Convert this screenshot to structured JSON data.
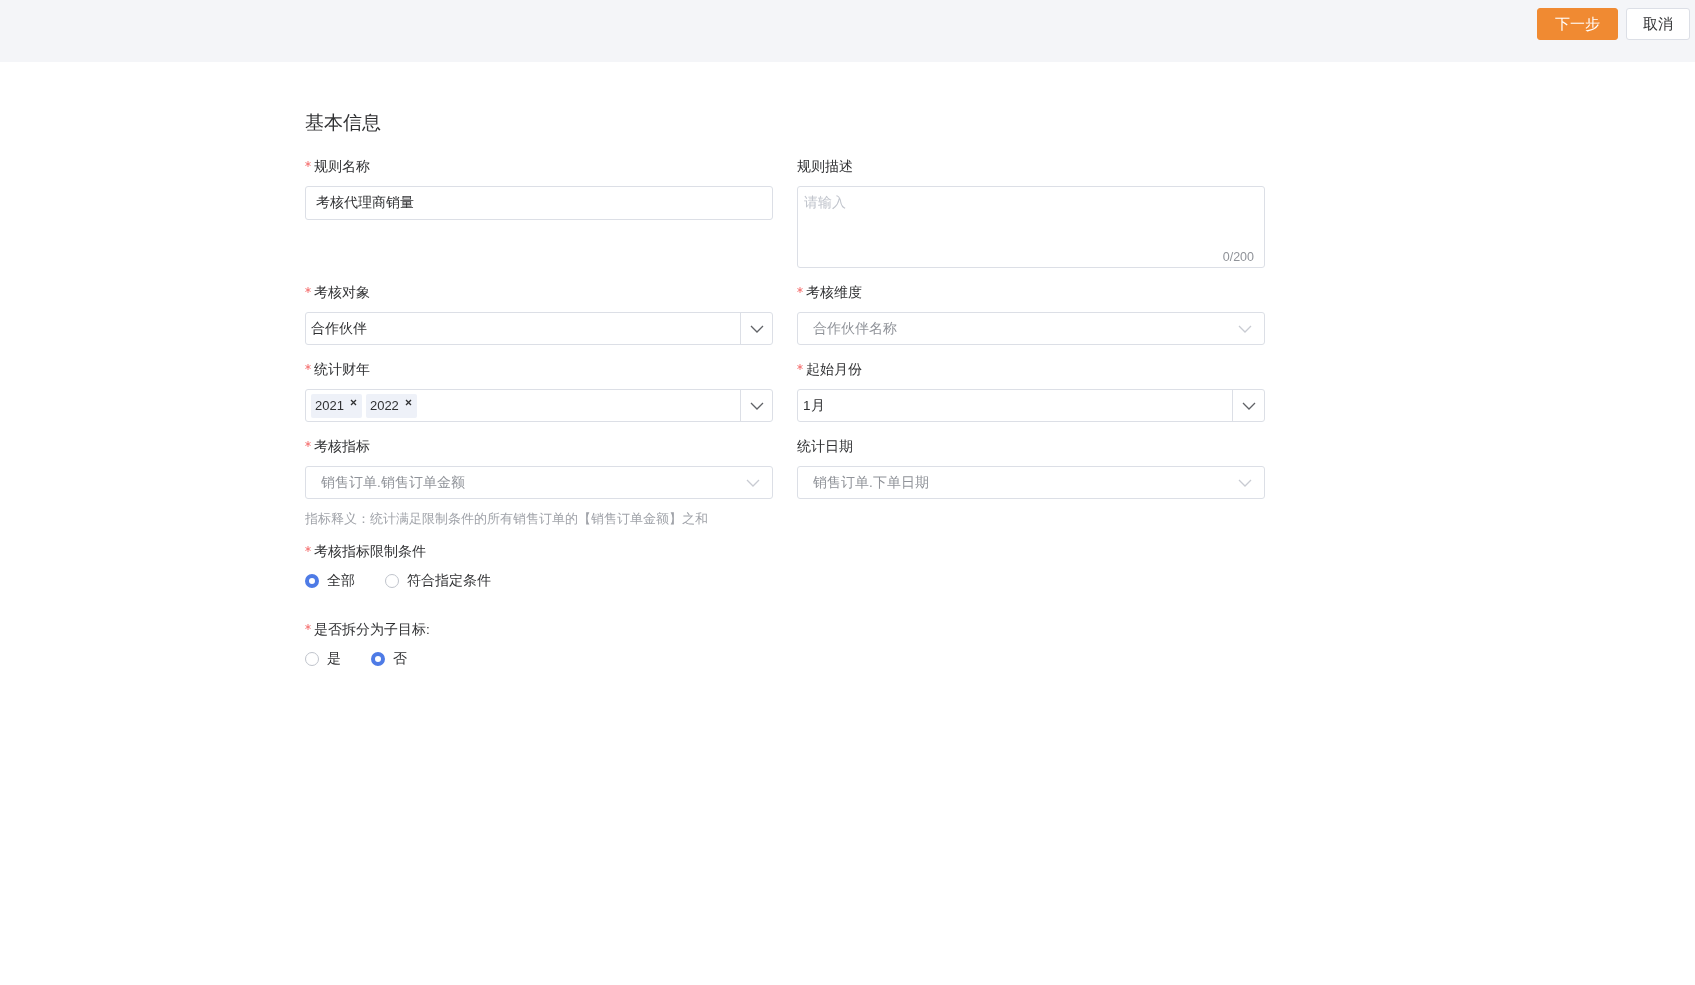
{
  "header": {
    "buttons": [
      {
        "label": "下一步",
        "kind": "primary"
      },
      {
        "label": "取消",
        "kind": "default"
      }
    ]
  },
  "section_title": "基本信息",
  "rows": [
    [
      {
        "label": "规则名称",
        "required": true,
        "kind": "input",
        "value": "考核代理商销量"
      },
      {
        "label": "规则描述",
        "required": false,
        "kind": "textarea",
        "placeholder": "请输入",
        "counter": "0/200"
      }
    ],
    [
      {
        "label": "考核对象",
        "required": true,
        "kind": "select",
        "value": "合作伙伴",
        "disabled": false
      },
      {
        "label": "考核维度",
        "required": true,
        "kind": "select",
        "value": "合作伙伴名称",
        "disabled": true
      }
    ],
    [
      {
        "label": "统计财年",
        "required": true,
        "kind": "tags",
        "tags": [
          "2021",
          "2022"
        ]
      },
      {
        "label": "起始月份",
        "required": true,
        "kind": "select",
        "value": "1月",
        "disabled": false
      }
    ],
    [
      {
        "label": "考核指标",
        "required": true,
        "kind": "select",
        "value": "销售订单.销售订单金额",
        "disabled": true,
        "hint": "指标释义：统计满足限制条件的所有销售订单的【销售订单金额】之和"
      },
      {
        "label": "统计日期",
        "required": false,
        "kind": "select",
        "value": "销售订单.下单日期",
        "disabled": true
      }
    ]
  ],
  "radio_groups": [
    {
      "label": "考核指标限制条件",
      "required": true,
      "options": [
        {
          "label": "全部",
          "selected": true
        },
        {
          "label": "符合指定条件",
          "selected": false
        }
      ]
    },
    {
      "label": "是否拆分为子目标:",
      "required": true,
      "options": [
        {
          "label": "是",
          "selected": false
        },
        {
          "label": "否",
          "selected": true
        }
      ]
    }
  ]
}
